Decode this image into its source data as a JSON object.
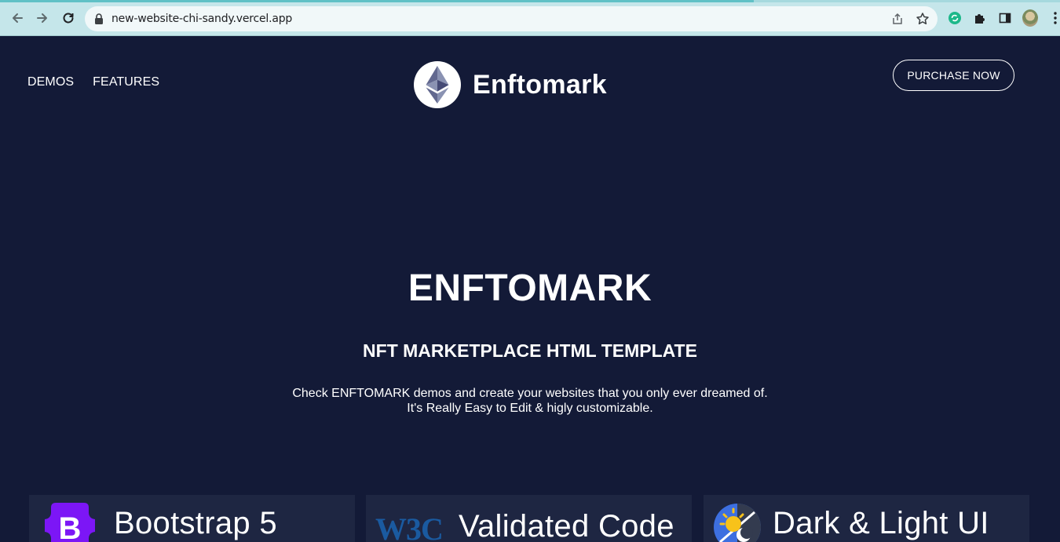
{
  "browser": {
    "url": "new-website-chi-sandy.vercel.app",
    "colors": {
      "chrome": "#c5e6ea",
      "tab_accent": "#60c1c6"
    },
    "icons": [
      "back-icon",
      "forward-icon",
      "reload-icon",
      "lock-icon",
      "share-icon",
      "star-icon",
      "extension-sync-icon",
      "puzzle-icon",
      "sidebar-icon",
      "profile-avatar",
      "menu-dots-icon"
    ]
  },
  "header": {
    "nav": [
      "DEMOS",
      "FEATURES"
    ],
    "brand": "Enftomark",
    "purchase_label": "PURCHASE NOW"
  },
  "hero": {
    "title": "ENFTOMARK",
    "subtitle": "NFT MARKETPLACE HTML TEMPLATE",
    "description_line1": "Check ENFTOMARK demos and create your websites that you only ever dreamed of.",
    "description_line2": "It's Really Easy to Edit & higly customizable."
  },
  "features": [
    {
      "icon": "bootstrap-icon",
      "label": "Bootstrap 5"
    },
    {
      "mark": "W3C",
      "label": "Validated Code"
    },
    {
      "icon": "dark-light-icon",
      "label": "Dark & Light UI"
    }
  ],
  "colors": {
    "background": "#131a37",
    "card": "#1e2642",
    "bootstrap": "#7c16f6",
    "w3c": "#1a5aa0"
  }
}
